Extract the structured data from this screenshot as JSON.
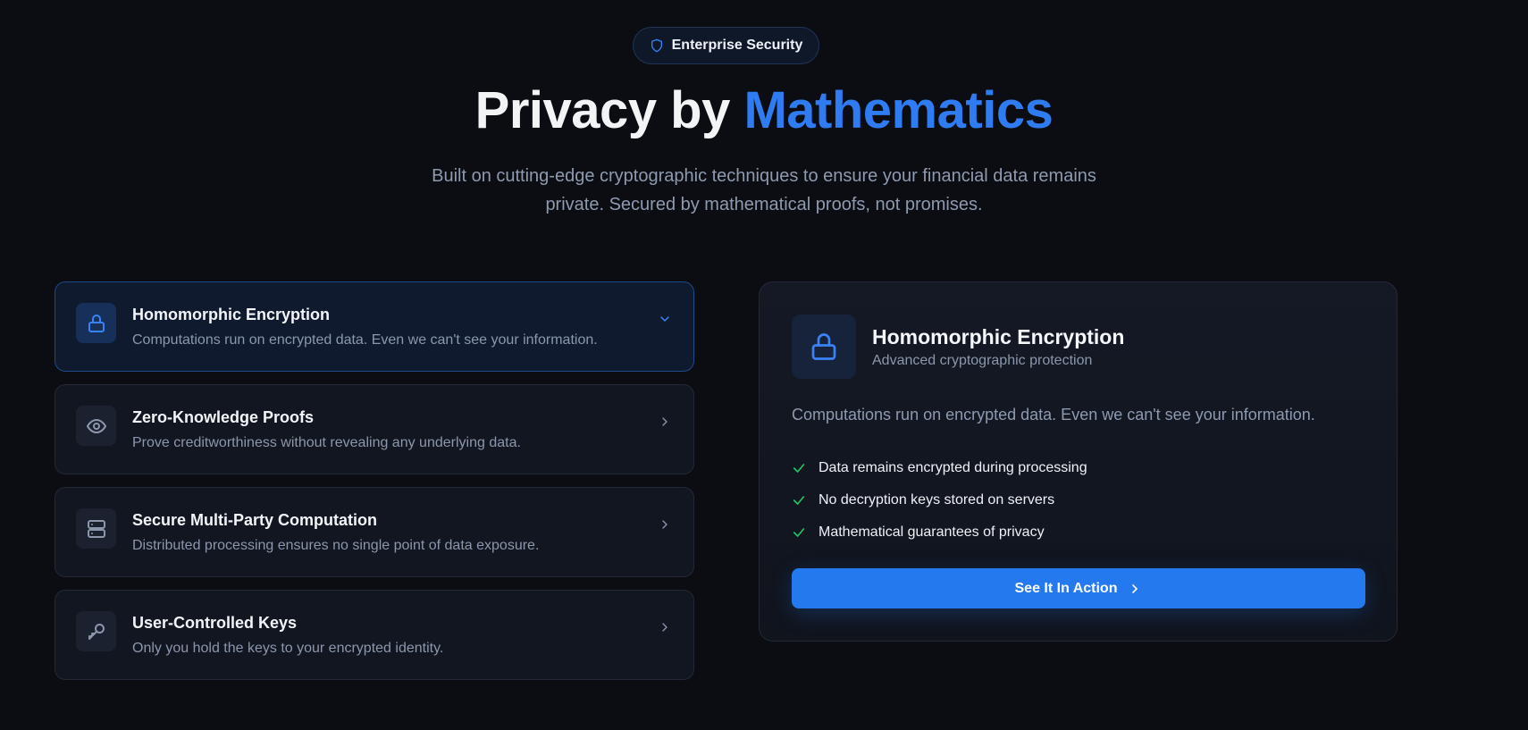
{
  "badge": {
    "icon": "shield-icon",
    "label": "Enterprise Security"
  },
  "hero": {
    "title_prefix": "Privacy by ",
    "title_accent": "Mathematics",
    "subtitle_line1": "Built on cutting-edge cryptographic techniques to ensure your financial data remains",
    "subtitle_line2": "private. Secured by mathematical proofs, not promises."
  },
  "features": [
    {
      "icon": "lock-icon",
      "title": "Homomorphic Encryption",
      "description": "Computations run on encrypted data. Even we can't see your information.",
      "active": true,
      "chevron": "chevron-down-icon"
    },
    {
      "icon": "eye-icon",
      "title": "Zero-Knowledge Proofs",
      "description": "Prove creditworthiness without revealing any underlying data.",
      "active": false,
      "chevron": "chevron-right-icon"
    },
    {
      "icon": "server-icon",
      "title": "Secure Multi-Party Computation",
      "description": "Distributed processing ensures no single point of data exposure.",
      "active": false,
      "chevron": "chevron-right-icon"
    },
    {
      "icon": "key-icon",
      "title": "User-Controlled Keys",
      "description": "Only you hold the keys to your encrypted identity.",
      "active": false,
      "chevron": "chevron-right-icon"
    }
  ],
  "detail": {
    "icon": "lock-icon",
    "title": "Homomorphic Encryption",
    "subtitle": "Advanced cryptographic protection",
    "description": "Computations run on encrypted data. Even we can't see your information.",
    "points": [
      "Data remains encrypted during processing",
      "No decryption keys stored on servers",
      "Mathematical guarantees of privacy"
    ],
    "cta_label": "See It In Action",
    "cta_icon": "chevron-right-icon"
  },
  "colors": {
    "background": "#0b0d12",
    "accent": "#2f7cf2",
    "check": "#22c55e",
    "muted_text": "#8b97ac"
  }
}
